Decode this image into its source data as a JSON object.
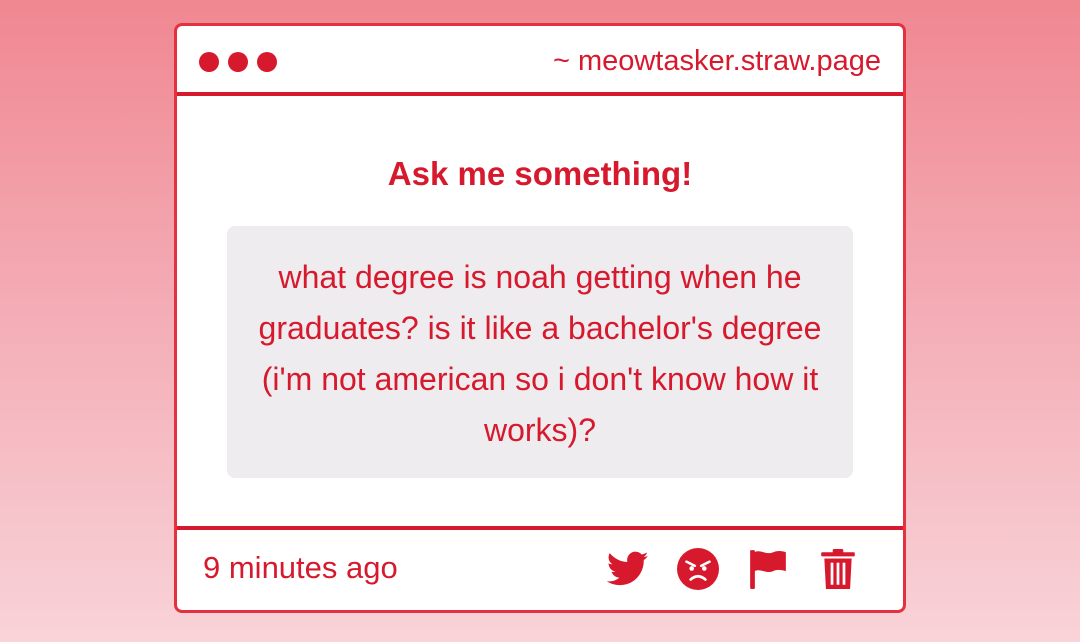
{
  "window": {
    "url": "~ meowtasker.straw.page"
  },
  "main": {
    "heading": "Ask me something!",
    "question": "what degree is noah getting when he graduates? is it like a bachelor's degree (i'm not american so i don't know how it works)?"
  },
  "footer": {
    "timestamp": "9 minutes ago",
    "actions": [
      {
        "icon": "twitter-icon",
        "name": "share-twitter-button"
      },
      {
        "icon": "angry-face-icon",
        "name": "angry-react-button"
      },
      {
        "icon": "flag-icon",
        "name": "report-button"
      },
      {
        "icon": "trash-icon",
        "name": "delete-button"
      }
    ]
  },
  "colors": {
    "accent": "#d7192d",
    "border": "#e3313f",
    "question_background": "#eeecee",
    "page_background_top": "#f08791",
    "page_background_bottom": "#f8d3d8"
  }
}
